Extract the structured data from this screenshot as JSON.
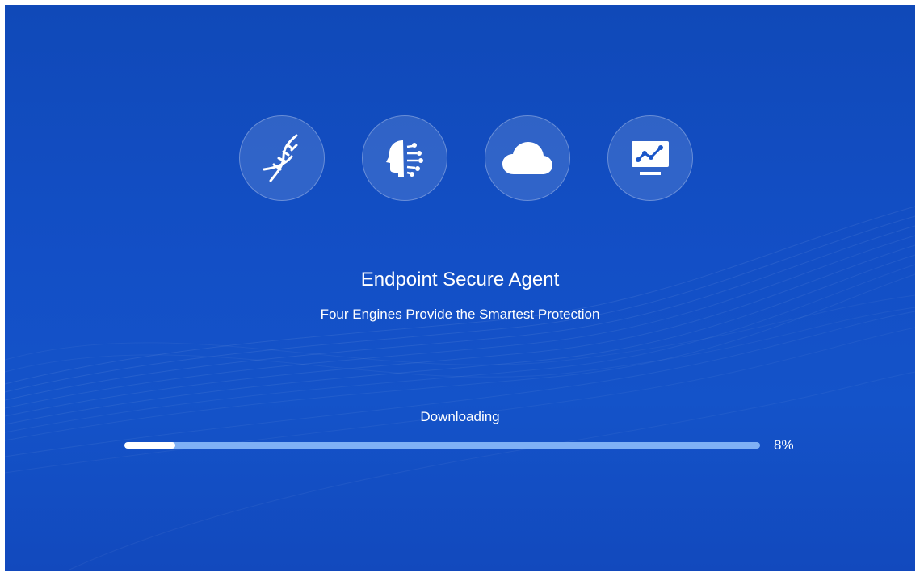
{
  "app": {
    "title": "Endpoint Secure Agent",
    "subtitle": "Four Engines Provide the Smartest Protection"
  },
  "engines": [
    {
      "icon": "dna-icon"
    },
    {
      "icon": "ai-head-icon"
    },
    {
      "icon": "cloud-icon"
    },
    {
      "icon": "monitor-chart-icon"
    }
  ],
  "progress": {
    "status": "Downloading",
    "percent": 8,
    "percent_label": "8%"
  },
  "colors": {
    "background": "#134fc6",
    "track": "#7fb0f5",
    "fill": "#ffffff",
    "text": "#ffffff"
  }
}
